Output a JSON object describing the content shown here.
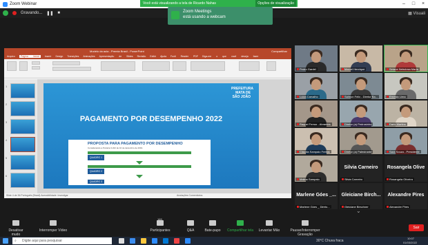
{
  "zoom": {
    "window_title": "Zoom Webinar",
    "recording": "Gravando...",
    "view_options": "Opções de visualização",
    "viewing_banner": "Você está visualizando a tela de Ricardo Nahas",
    "toast_title": "Zoom Meetings",
    "toast_text": "está usando a webcam",
    "exhibit_label": "Visuali"
  },
  "powerpoint": {
    "title": "Modelo da aula - Premia Brasil - PowerPoint",
    "tabs": [
      "Arquivo",
      "Página Inicial",
      "Inserir",
      "Design",
      "Transições",
      "Animações",
      "Apresentação de Slides",
      "Revisão",
      "Exibir",
      "Ajuda",
      "Foxit Reader PDF"
    ],
    "tell_me": "Diga-me o que você deseja fazer",
    "share": "Compartilhar",
    "status": "Slide 4 de 36    Português (Brasil)    Acessibilidade: Investigar",
    "status_right": "Anotações    Comentários"
  },
  "slide": {
    "title": "PAGAMENTO POR DESEMPENHO 2022",
    "logo": "PREFEITURA MATA DE SÃO JOÃO",
    "card_heading": "PROPOSTA PARA PAGAMENTO POR DESEMPENHO",
    "card_sub": "Considerando a Portaria 3.222 de 10 de dezembro de 2019.",
    "rows": [
      "QUADRO 1",
      "QUADRO 2",
      "QUADRO 3"
    ]
  },
  "participants": [
    {
      "name": "Pedro Gardel",
      "type": "video"
    },
    {
      "name": "Marcel Henrique",
      "type": "video"
    },
    {
      "name": "Setane Nebulosa Maria",
      "type": "video",
      "active": true
    },
    {
      "name": "Luiza Carvalho",
      "type": "video"
    },
    {
      "name": "Salmon Felix - Diretor Ba...",
      "type": "video"
    },
    {
      "name": "Ernesto Lima",
      "type": "video"
    },
    {
      "name": "Raquel Ferraz - Abrantes",
      "type": "video"
    },
    {
      "name": "Diretor (a) Pedrosinho",
      "type": "video"
    },
    {
      "name": "Dario Martins",
      "type": "video"
    },
    {
      "name": "Cláudia Sampaio Freitas",
      "type": "video"
    },
    {
      "name": "Diretor (a) Palestrante",
      "type": "video"
    },
    {
      "name": "Sara Souza - Presidente",
      "type": "video"
    },
    {
      "name": "Malina Sampaio",
      "type": "video"
    },
    {
      "name": "Silvia Carneiro",
      "type": "name",
      "big": "Silvia Carneiro"
    },
    {
      "name": "Rosangela Oliveira",
      "type": "name",
      "big": "Rosangela Olive"
    },
    {
      "name": "Marlene Góes _ Direto...",
      "type": "name",
      "big": "Marlene Góes _..."
    },
    {
      "name": "Gleiciane Birschner",
      "type": "name",
      "big": "Gleiciane Birch..."
    },
    {
      "name": "Alexandre Pires",
      "type": "name",
      "big": "Alexandre Pires"
    }
  ],
  "controls": {
    "audio": "Desativar mudo",
    "video": "Interromper Vídeo",
    "participants": "Participantes",
    "participants_count": "169",
    "qa": "Q&A",
    "chat": "Bate-papo",
    "share": "Compartilhar tela",
    "raise": "Levantar Mão",
    "pause": "Pausar/Interromper Gravação",
    "leave": "Sair"
  },
  "taskbar": {
    "search": "Digite aqui para pesquisar",
    "weather": "30°C  Chuva fraca",
    "time": "10:07",
    "date": "01/03/2022"
  }
}
